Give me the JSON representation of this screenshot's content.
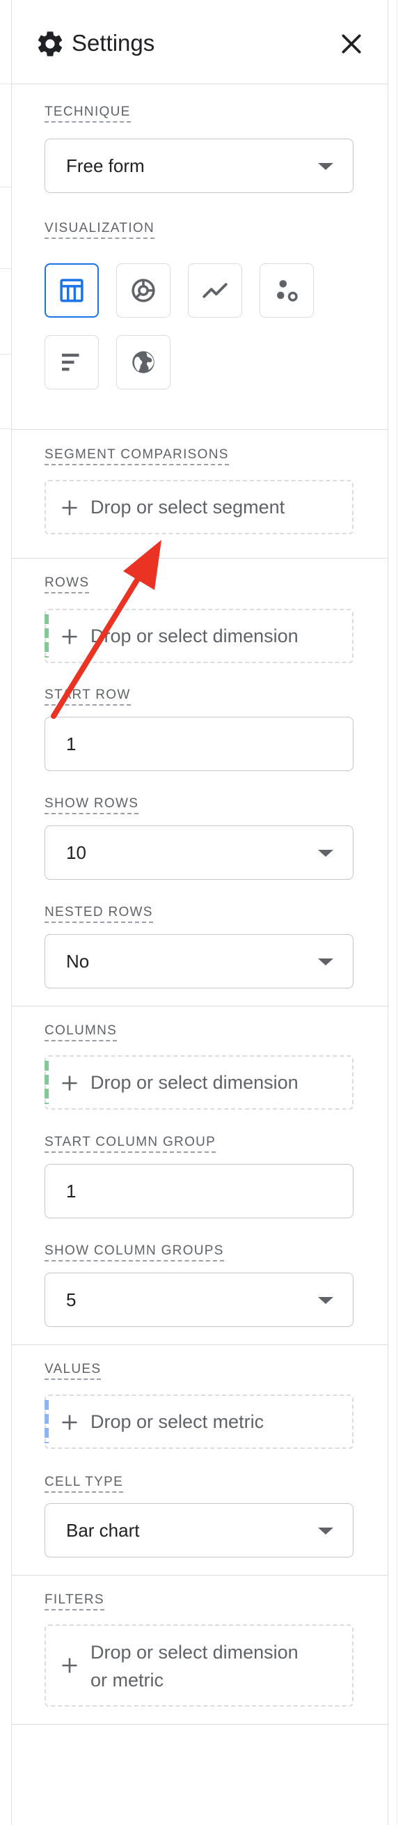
{
  "header": {
    "title": "Settings"
  },
  "technique": {
    "label": "TECHNIQUE",
    "value": "Free form"
  },
  "visualization": {
    "label": "VISUALIZATION",
    "icons": [
      "table-icon",
      "donut-chart-icon",
      "line-chart-icon",
      "scatter-plot-icon",
      "bar-chart-icon",
      "globe-icon"
    ],
    "selected": "table-icon"
  },
  "segment_comparisons": {
    "label": "SEGMENT COMPARISONS",
    "placeholder": "Drop or select segment"
  },
  "rows": {
    "label": "ROWS",
    "placeholder": "Drop or select dimension",
    "start_row_label": "START ROW",
    "start_row_value": "1",
    "show_rows_label": "SHOW ROWS",
    "show_rows_value": "10",
    "nested_rows_label": "NESTED ROWS",
    "nested_rows_value": "No"
  },
  "columns": {
    "label": "COLUMNS",
    "placeholder": "Drop or select dimension",
    "start_group_label": "START COLUMN GROUP",
    "start_group_value": "1",
    "show_groups_label": "SHOW COLUMN GROUPS",
    "show_groups_value": "5"
  },
  "values": {
    "label": "VALUES",
    "placeholder": "Drop or select metric",
    "cell_type_label": "CELL TYPE",
    "cell_type_value": "Bar chart"
  },
  "filters": {
    "label": "FILTERS",
    "placeholder_line1": "Drop or select dimension",
    "placeholder_line2": "or metric"
  },
  "colors": {
    "accent_blue": "#1a73e8",
    "dimension_green": "#81c995",
    "metric_blue": "#8ab4f8",
    "annotation_red": "#ea3323"
  }
}
